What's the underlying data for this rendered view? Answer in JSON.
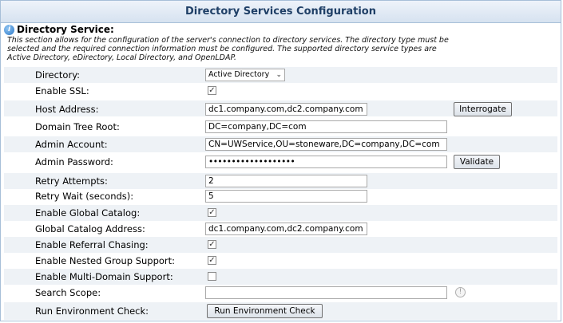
{
  "title": "Directory Services Configuration",
  "section": {
    "heading": "Directory Service:",
    "description": "This section allows for the configuration of the server's connection to directory services. The directory type must be selected and the required connection information must be configured. The supported directory service types are Active Directory, eDirectory, Local Directory, and OpenLDAP."
  },
  "fields": {
    "directory": {
      "label": "Directory:",
      "value": "Active Directory"
    },
    "enable_ssl": {
      "label": "Enable SSL:",
      "checked": true
    },
    "host_address": {
      "label": "Host Address:",
      "value": "dc1.company.com,dc2.company.com",
      "button": "Interrogate"
    },
    "domain_tree_root": {
      "label": "Domain Tree Root:",
      "value": "DC=company,DC=com"
    },
    "admin_account": {
      "label": "Admin Account:",
      "value": "CN=UWService,OU=stoneware,DC=company,DC=com"
    },
    "admin_password": {
      "label": "Admin Password:",
      "value": "•••••••••••••••••••",
      "button": "Validate"
    },
    "retry_attempts": {
      "label": "Retry Attempts:",
      "value": "2"
    },
    "retry_wait": {
      "label": "Retry Wait (seconds):",
      "value": "5"
    },
    "enable_global_catalog": {
      "label": "Enable Global Catalog:",
      "checked": true
    },
    "global_catalog_address": {
      "label": "Global Catalog Address:",
      "value": "dc1.company.com,dc2.company.com"
    },
    "enable_referral_chasing": {
      "label": "Enable Referral Chasing:",
      "checked": true
    },
    "enable_nested_group_support": {
      "label": "Enable Nested Group Support:",
      "checked": true
    },
    "enable_multi_domain_support": {
      "label": "Enable Multi-Domain Support:",
      "checked": false
    },
    "search_scope": {
      "label": "Search Scope:",
      "value": ""
    },
    "run_environment_check": {
      "label": "Run Environment Check:",
      "button": "Run Environment Check"
    }
  },
  "colors": {
    "title_text": "#1f3f66",
    "frame_border": "#a7bfd8",
    "row_alt": "#eef2f6"
  }
}
